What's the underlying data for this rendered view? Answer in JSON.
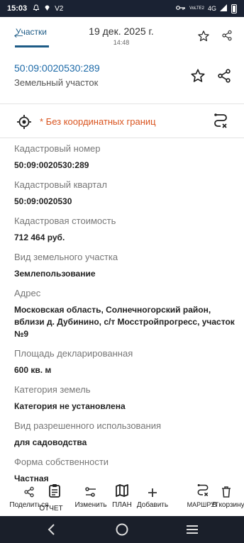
{
  "status": {
    "time": "15:03",
    "left_icons": [
      "alarm-bell-icon",
      "location-icon"
    ],
    "carrier": "V2",
    "network": "4G",
    "network_sub": "VoLTE2",
    "right_icons": [
      "key-icon",
      "signal-icon",
      "battery-icon"
    ]
  },
  "appbar": {
    "tab_label": "Участки",
    "date": "19 дек. 2025 г.",
    "time": "14:48"
  },
  "parcel": {
    "cadastral_number": "50:09:0020530:289",
    "type": "Земельный участок",
    "no_coords": "* Без координатных границ"
  },
  "fields": [
    {
      "label": "Кадастровый номер",
      "value": "50:09:0020530:289"
    },
    {
      "label": "Кадастровый квартал",
      "value": "50:09:0020530"
    },
    {
      "label": "Кадастровая стоимость",
      "value": "712 464 руб."
    },
    {
      "label": "Вид земельного участка",
      "value": "Землепользование"
    },
    {
      "label": "Адрес",
      "value": "Московская область, Солнечногорский район, вблизи д. Дубинино, с/т Мосстройпрогресс, участок №9"
    },
    {
      "label": "Площадь декларированная",
      "value": "600 кв. м"
    },
    {
      "label": "Категория земель",
      "value": "Категория не установлена"
    },
    {
      "label": "Вид разрешенного использования",
      "value": "для садоводства"
    },
    {
      "label": "Форма собственности",
      "value": "Частная"
    }
  ],
  "bottom_actions": [
    {
      "label": "Поделиться",
      "icon": "share-icon"
    },
    {
      "label": "ОТЧЕТ",
      "icon": "clipboard-icon"
    },
    {
      "label": "Изменить",
      "icon": "edit-icon"
    },
    {
      "label": "ПЛАН",
      "icon": "map-icon"
    },
    {
      "label": "Добавить",
      "icon": "plus-icon"
    },
    {
      "label": "МАРШРУТ",
      "icon": "route-icon"
    },
    {
      "label": "В корзину",
      "icon": "trash-icon"
    }
  ],
  "colors": {
    "accent": "#1d6aa8",
    "warning": "#d9541f",
    "statusbar": "#1a2233",
    "navbar": "#1a1f2a"
  }
}
